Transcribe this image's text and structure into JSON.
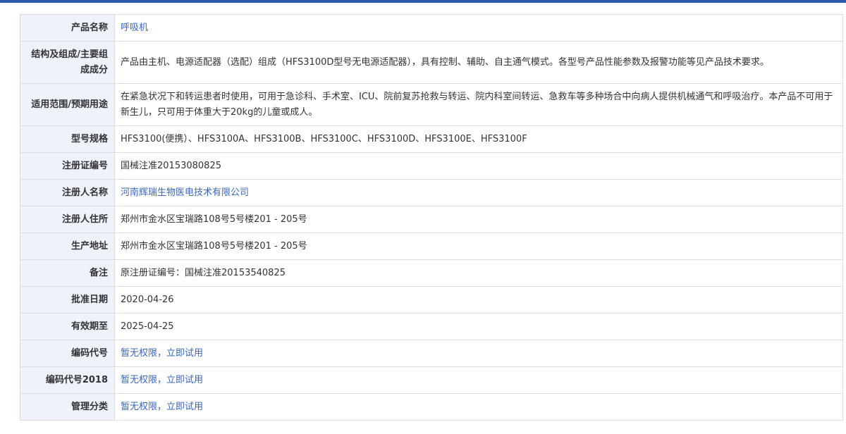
{
  "colors": {
    "accent_bar": "#2b5aa8",
    "label_bg": "#eef3fb",
    "link": "#3b67b5"
  },
  "rows": [
    {
      "label": "产品名称",
      "value": "呼吸机"
    },
    {
      "label": "结构及组成/主要组成成分",
      "value": "产品由主机、电源适配器（选配）组成（HFS3100D型号无电源适配器），具有控制、辅助、自主通气模式。各型号产品性能参数及报警功能等见产品技术要求。"
    },
    {
      "label": "适用范围/预期用途",
      "value": "在紧急状况下和转运患者时使用，可用于急诊科、手术室、ICU、院前复苏抢救与转运、院内科室间转运、急救车等多种场合中向病人提供机械通气和呼吸治疗。本产品不可用于新生儿，只可用于体重大于20kg的儿童或成人。"
    },
    {
      "label": "型号规格",
      "value": "HFS3100(便携）、HFS3100A、HFS3100B、HFS3100C、HFS3100D、HFS3100E、HFS3100F"
    },
    {
      "label": "注册证编号",
      "value": "国械注准20153080825"
    },
    {
      "label": "注册人名称",
      "value": "河南辉瑞生物医电技术有限公司"
    },
    {
      "label": "注册人住所",
      "value": "郑州市金水区宝瑞路108号5号楼201 - 205号"
    },
    {
      "label": "生产地址",
      "value": "郑州市金水区宝瑞路108号5号楼201 - 205号"
    },
    {
      "label": "备注",
      "value": "原注册证编号：国械注准20153540825"
    },
    {
      "label": "批准日期",
      "value": "2020-04-26"
    },
    {
      "label": "有效期至",
      "value": "2025-04-25"
    },
    {
      "label": "编码代号",
      "value": "暂无权限，立即试用"
    },
    {
      "label": "编码代号2018",
      "value": "暂无权限，立即试用"
    },
    {
      "label": "管理分类",
      "value": "暂无权限，立即试用"
    }
  ]
}
